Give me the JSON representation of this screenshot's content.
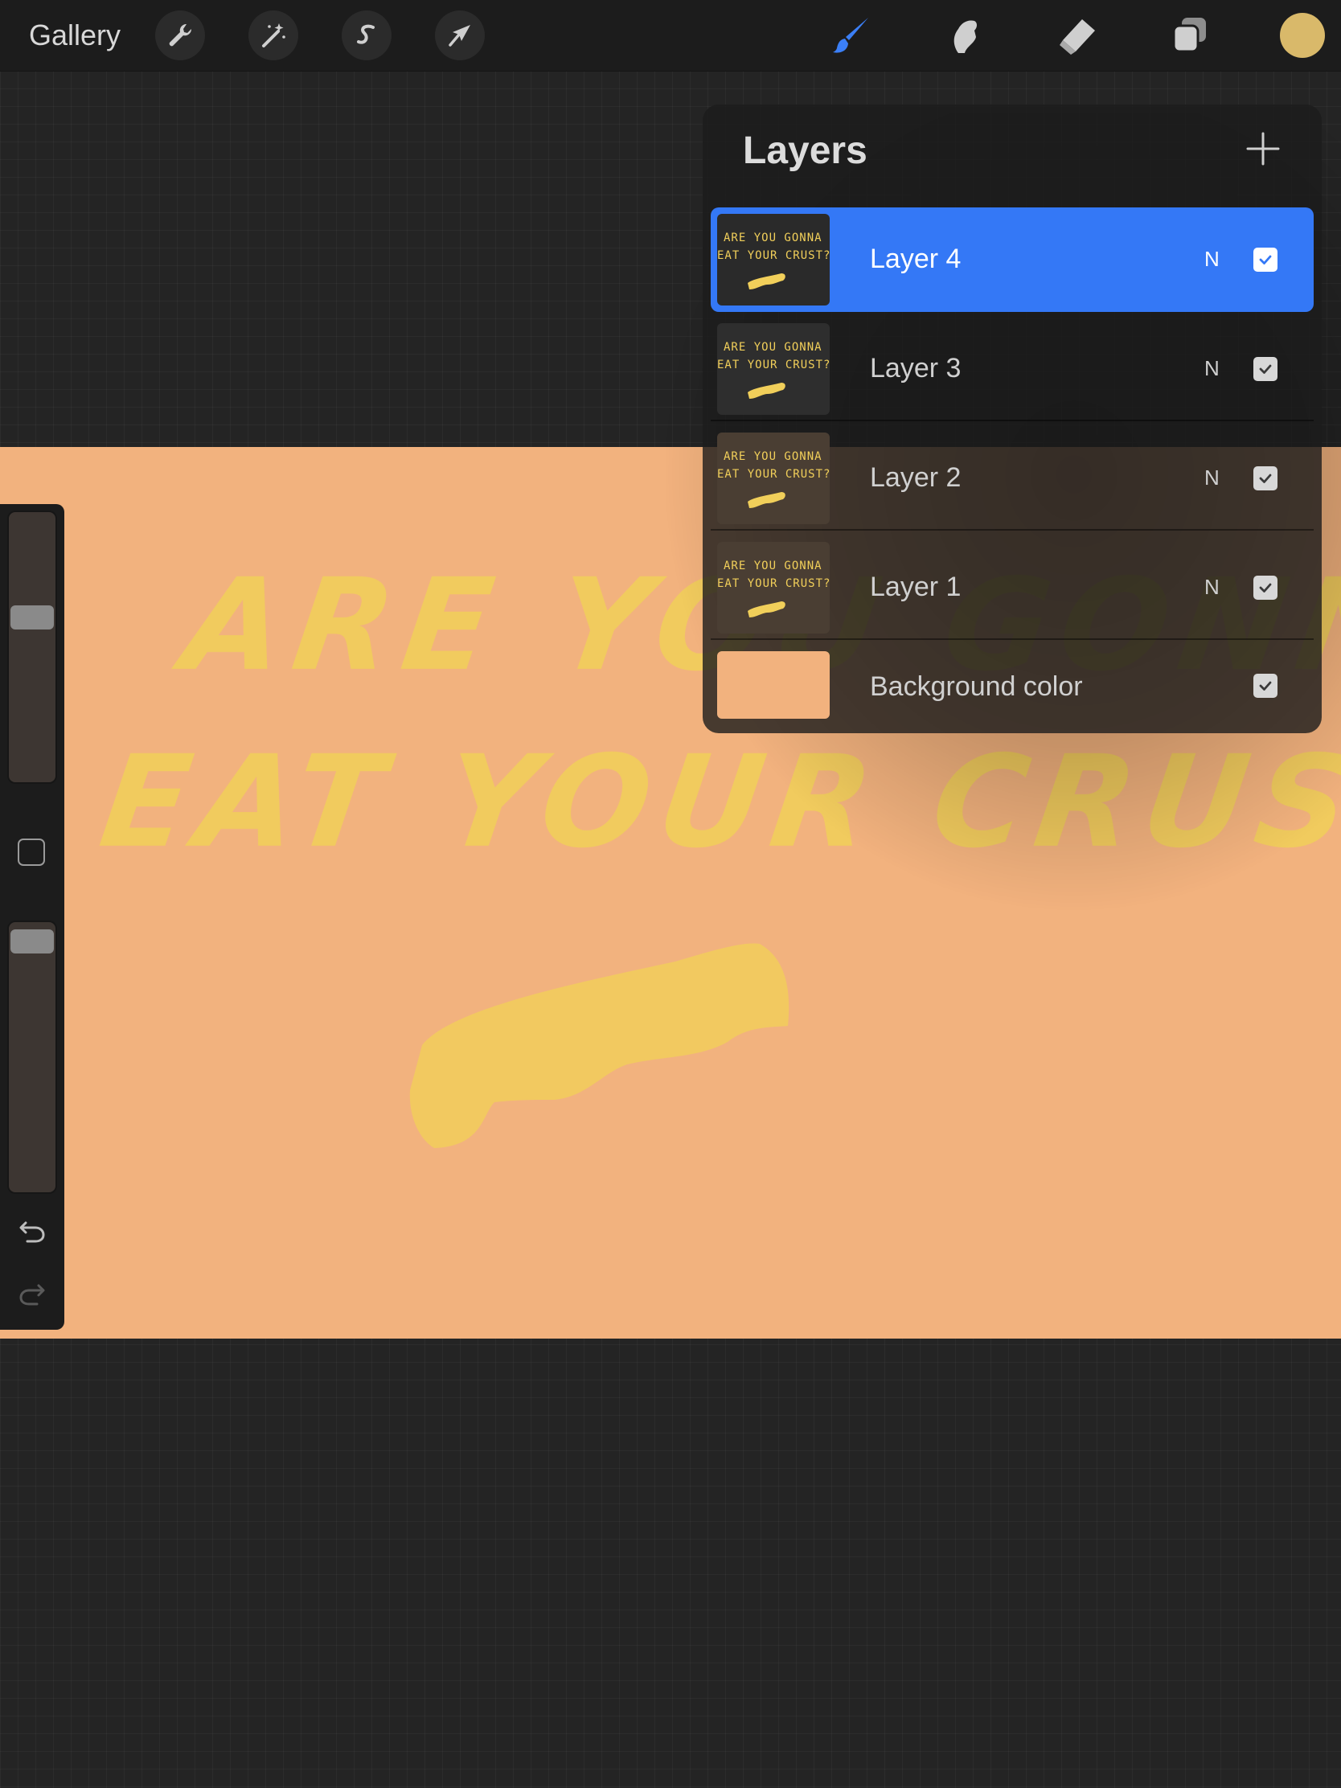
{
  "toolbar": {
    "gallery_label": "Gallery",
    "left_tools": [
      {
        "name": "actions-wrench-icon"
      },
      {
        "name": "adjustments-magic-wand-icon"
      },
      {
        "name": "selection-s-icon"
      },
      {
        "name": "transform-arrow-icon"
      }
    ],
    "right_tools": [
      {
        "name": "brush-icon",
        "active": true
      },
      {
        "name": "smudge-icon",
        "active": false
      },
      {
        "name": "eraser-icon",
        "active": false
      },
      {
        "name": "layers-icon",
        "active": false
      }
    ],
    "current_color": "#d9b96a",
    "active_tool_color": "#3b7ff6"
  },
  "canvas": {
    "background_color": "#f2b27e",
    "text_line_1": "ARE YOU GONNA",
    "text_line_2": "EAT YOUR CRUST?",
    "paint_color": "#f1cf5a"
  },
  "sidebar": {
    "brush_size_level": 0.62,
    "opacity_level": 0.97,
    "undo_icon": "undo-icon",
    "redo_icon": "redo-icon"
  },
  "layers_panel": {
    "title": "Layers",
    "add_icon": "plus-icon",
    "layers": [
      {
        "name": "Layer 4",
        "blend": "N",
        "visible": true,
        "selected": true,
        "thumb_line_1": "ARE YOU GONNA",
        "thumb_line_2": "EAT YOUR CRUST?"
      },
      {
        "name": "Layer 3",
        "blend": "N",
        "visible": true,
        "selected": false,
        "thumb_line_1": "ARE YOU GONNA",
        "thumb_line_2": "EAT YOUR CRUST?"
      },
      {
        "name": "Layer 2",
        "blend": "N",
        "visible": true,
        "selected": false,
        "thumb_line_1": "ARE YOU GONNA",
        "thumb_line_2": "EAT YOUR CRUST?"
      },
      {
        "name": "Layer 1",
        "blend": "N",
        "visible": true,
        "selected": false,
        "thumb_line_1": "ARE YOU GONNA",
        "thumb_line_2": "EAT YOUR CRUST?"
      }
    ],
    "background": {
      "name": "Background color",
      "color": "#f2b27e",
      "visible": true
    },
    "selected_color": "#3478f6"
  }
}
